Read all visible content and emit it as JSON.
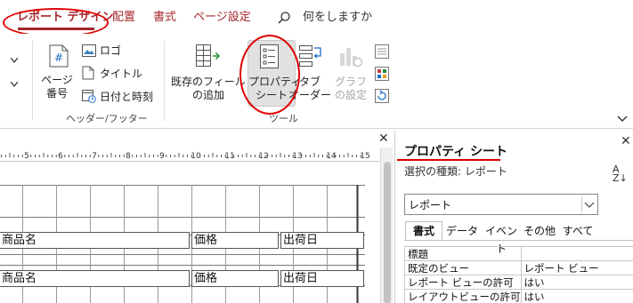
{
  "tabs": [
    {
      "label": "レポート デザイン",
      "active": true
    },
    {
      "label": "配置"
    },
    {
      "label": "書式"
    },
    {
      "label": "ページ設定"
    }
  ],
  "search": {
    "placeholder": "何をしますか"
  },
  "ribbon": {
    "header_footer": {
      "page_number": {
        "line1": "ページ",
        "line2": "番号"
      },
      "logo": "ロゴ",
      "title": "タイトル",
      "date_time": "日付と時刻",
      "group_label": "ヘッダー/フッター"
    },
    "tools": {
      "add_existing_fields": {
        "line1": "既存のフィールド",
        "line2": "の追加"
      },
      "property_sheet": {
        "line1": "プロパティ",
        "line2": "シート"
      },
      "tab_order": {
        "line1": "タブ",
        "line2": "オーダー"
      },
      "chart_settings": {
        "line1": "グラフ",
        "line2": "の設定"
      },
      "group_label": "ツール"
    }
  },
  "ruler": {
    "labels": [
      "5",
      "6",
      "7",
      "8",
      "9",
      "10",
      "11",
      "12",
      "13",
      "14",
      "15"
    ]
  },
  "design": {
    "labels": {
      "product_name": "商品名",
      "price": "価格",
      "ship_date": "出荷日"
    }
  },
  "property_sheet": {
    "title": "プロパティ シート",
    "selection_type": "選択の種類:  レポート",
    "selected_object": "レポート",
    "tabs": [
      "書式",
      "データ",
      "イベント",
      "その他",
      "すべて"
    ],
    "rows": [
      {
        "name": "標題",
        "value": ""
      },
      {
        "name": "既定のビュー",
        "value": "レポート ビュー"
      },
      {
        "name": "レポート ビューの許可",
        "value": "はい"
      },
      {
        "name": "レイアウトビューの許可",
        "value": "はい"
      }
    ]
  },
  "colors": {
    "accent": "#a4262c",
    "highlight_circle": "#e00000"
  }
}
